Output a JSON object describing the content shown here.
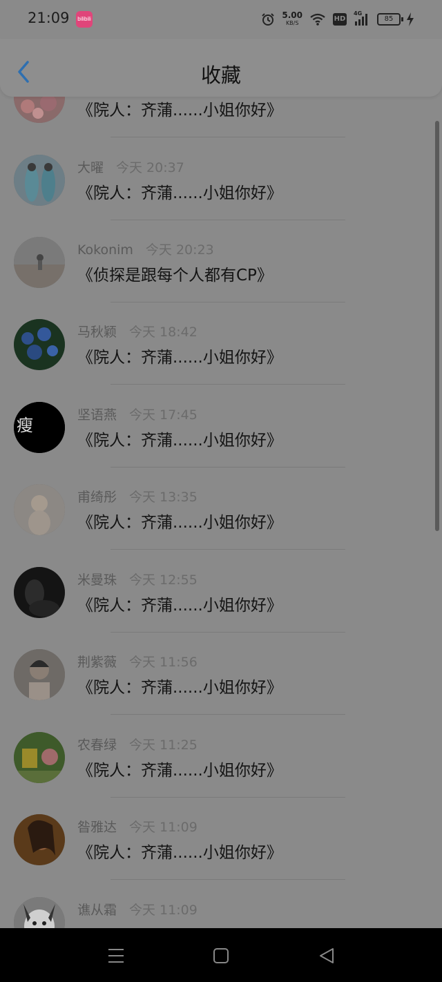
{
  "status_bar": {
    "time": "21:09",
    "app_badge": "bilibili",
    "net_speed_value": "5.00",
    "net_speed_unit": "KB/S",
    "hd": "HD",
    "signal_label": "4G",
    "battery": "85"
  },
  "header": {
    "title": "收藏"
  },
  "items": [
    {
      "name": "",
      "time": "",
      "message": "《院人：齐蒲......小姐你好》"
    },
    {
      "name": "大曜",
      "time": "今天 20:37",
      "message": "《院人：齐蒲......小姐你好》"
    },
    {
      "name": "Kokonim",
      "time": "今天 20:23",
      "message": "《侦探是跟每个人都有CP》"
    },
    {
      "name": "马秋颖",
      "time": "今天 18:42",
      "message": "《院人：齐蒲......小姐你好》"
    },
    {
      "name": "坚语燕",
      "time": "今天 17:45",
      "message": "《院人：齐蒲......小姐你好》"
    },
    {
      "name": "甫绮彤",
      "time": "今天 13:35",
      "message": "《院人：齐蒲......小姐你好》"
    },
    {
      "name": "米曼珠",
      "time": "今天 12:55",
      "message": "《院人：齐蒲......小姐你好》"
    },
    {
      "name": "荆紫薇",
      "time": "今天 11:56",
      "message": "《院人：齐蒲......小姐你好》"
    },
    {
      "name": "农春绿",
      "time": "今天 11:25",
      "message": "《院人：齐蒲......小姐你好》"
    },
    {
      "name": "昝雅达",
      "time": "今天 11:09",
      "message": "《院人：齐蒲......小姐你好》"
    },
    {
      "name": "谯从霜",
      "time": "今天 11:09",
      "message": ""
    }
  ],
  "avatar_text": {
    "item4": "瘦"
  },
  "colors": {
    "overlay_bg": "#8a8a8a",
    "accent": "#2e6fb0",
    "text_primary": "#141414",
    "text_secondary": "#5a5a5a"
  },
  "icons": {
    "back": "chevron-left-icon",
    "alarm": "alarm-icon",
    "wifi": "wifi-icon",
    "signal": "signal-icon",
    "battery": "battery-icon",
    "charging": "lightning-icon",
    "menu": "menu-icon",
    "home": "home-square-icon",
    "back_sys": "triangle-back-icon"
  }
}
